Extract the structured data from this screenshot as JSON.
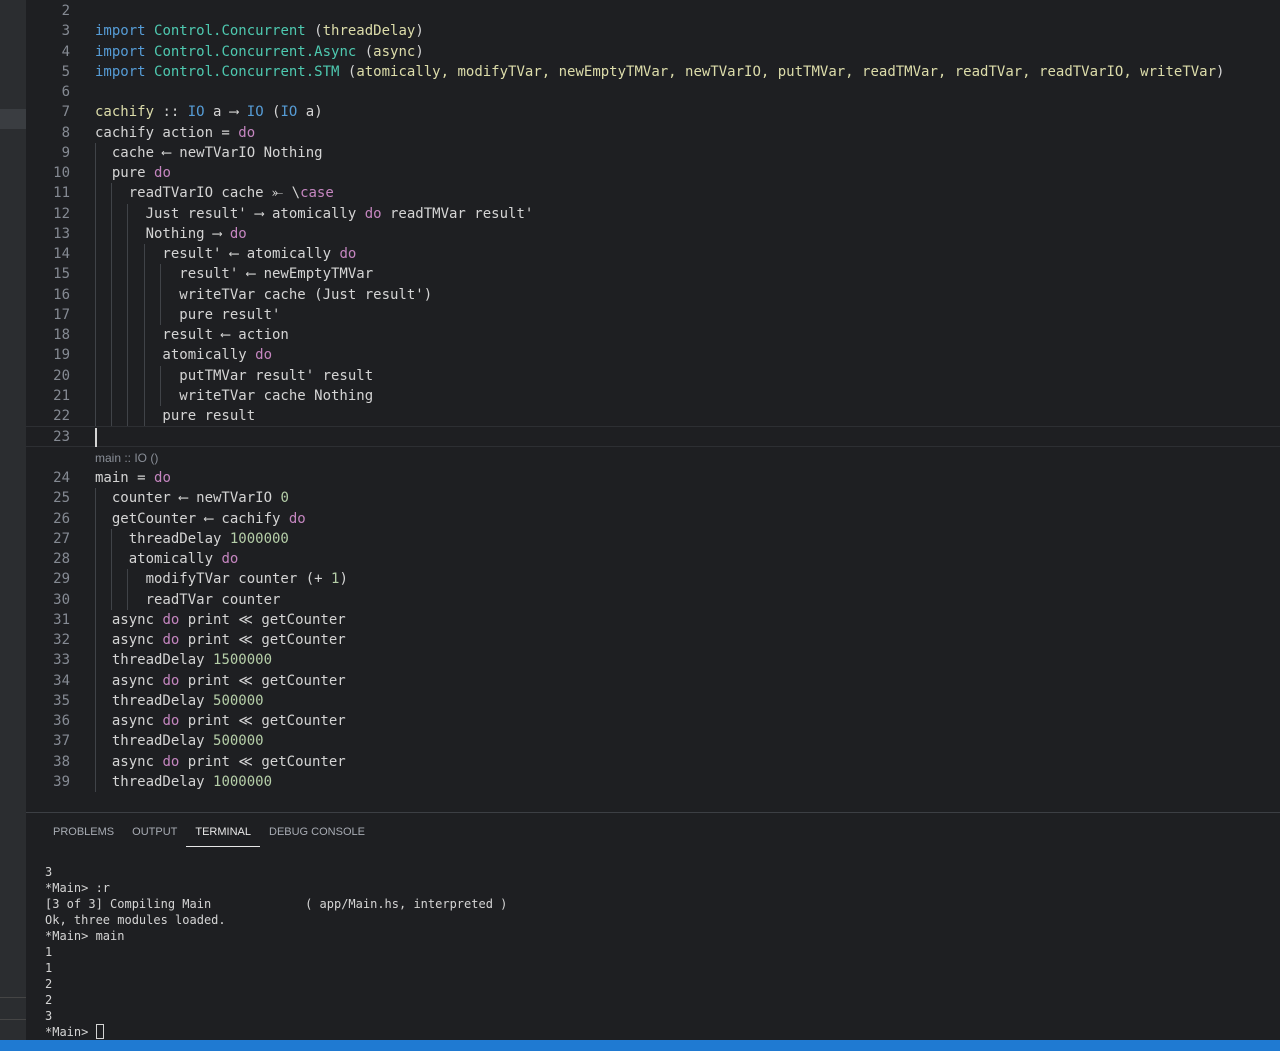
{
  "editor": {
    "lines": [
      {
        "n": "2",
        "tokens": []
      },
      {
        "n": "3",
        "tokens": [
          {
            "t": "import",
            "c": "kw"
          },
          {
            "t": " ",
            "c": "plain"
          },
          {
            "t": "Control.Concurrent",
            "c": "mod"
          },
          {
            "t": " (",
            "c": "plain"
          },
          {
            "t": "threadDelay",
            "c": "fn"
          },
          {
            "t": ")",
            "c": "plain"
          }
        ]
      },
      {
        "n": "4",
        "tokens": [
          {
            "t": "import",
            "c": "kw"
          },
          {
            "t": " ",
            "c": "plain"
          },
          {
            "t": "Control.Concurrent.Async",
            "c": "mod"
          },
          {
            "t": " (",
            "c": "plain"
          },
          {
            "t": "async",
            "c": "fn"
          },
          {
            "t": ")",
            "c": "plain"
          }
        ]
      },
      {
        "n": "5",
        "tokens": [
          {
            "t": "import",
            "c": "kw"
          },
          {
            "t": " ",
            "c": "plain"
          },
          {
            "t": "Control.Concurrent.STM",
            "c": "mod"
          },
          {
            "t": " (",
            "c": "plain"
          },
          {
            "t": "atomically, modifyTVar, newEmptyTMVar, newTVarIO, putTMVar, readTMVar, readTVar, readTVarIO, writeTVar",
            "c": "fn"
          },
          {
            "t": ")",
            "c": "plain"
          }
        ]
      },
      {
        "n": "6",
        "tokens": []
      },
      {
        "n": "7",
        "tokens": [
          {
            "t": "cachify",
            "c": "fn"
          },
          {
            "t": " :: ",
            "c": "plain"
          },
          {
            "t": "IO",
            "c": "ty"
          },
          {
            "t": " a ",
            "c": "plain"
          },
          {
            "t": "⟶",
            "c": "plain"
          },
          {
            "t": " ",
            "c": "plain"
          },
          {
            "t": "IO",
            "c": "ty"
          },
          {
            "t": " (",
            "c": "plain"
          },
          {
            "t": "IO",
            "c": "ty"
          },
          {
            "t": " a)",
            "c": "plain"
          }
        ]
      },
      {
        "n": "8",
        "tokens": [
          {
            "t": "cachify action = ",
            "c": "plain"
          },
          {
            "t": "do",
            "c": "do"
          }
        ]
      },
      {
        "n": "9",
        "tokens": [
          {
            "t": "  cache ⟵ newTVarIO Nothing",
            "c": "plain"
          }
        ]
      },
      {
        "n": "10",
        "tokens": [
          {
            "t": "  pure ",
            "c": "plain"
          },
          {
            "t": "do",
            "c": "do"
          }
        ]
      },
      {
        "n": "11",
        "tokens": [
          {
            "t": "    readTVarIO cache ⤜ \\",
            "c": "plain"
          },
          {
            "t": "case",
            "c": "do"
          }
        ]
      },
      {
        "n": "12",
        "tokens": [
          {
            "t": "      Just result' ⟶ atomically ",
            "c": "plain"
          },
          {
            "t": "do",
            "c": "do"
          },
          {
            "t": " readTMVar result'",
            "c": "plain"
          }
        ]
      },
      {
        "n": "13",
        "tokens": [
          {
            "t": "      Nothing ⟶ ",
            "c": "plain"
          },
          {
            "t": "do",
            "c": "do"
          }
        ]
      },
      {
        "n": "14",
        "tokens": [
          {
            "t": "        result' ⟵ atomically ",
            "c": "plain"
          },
          {
            "t": "do",
            "c": "do"
          }
        ]
      },
      {
        "n": "15",
        "tokens": [
          {
            "t": "          result' ⟵ newEmptyTMVar",
            "c": "plain"
          }
        ]
      },
      {
        "n": "16",
        "tokens": [
          {
            "t": "          writeTVar cache (Just result')",
            "c": "plain"
          }
        ]
      },
      {
        "n": "17",
        "tokens": [
          {
            "t": "          pure result'",
            "c": "plain"
          }
        ]
      },
      {
        "n": "18",
        "tokens": [
          {
            "t": "        result ⟵ action",
            "c": "plain"
          }
        ]
      },
      {
        "n": "19",
        "tokens": [
          {
            "t": "        atomically ",
            "c": "plain"
          },
          {
            "t": "do",
            "c": "do"
          }
        ]
      },
      {
        "n": "20",
        "tokens": [
          {
            "t": "          putTMVar result' result",
            "c": "plain"
          }
        ]
      },
      {
        "n": "21",
        "tokens": [
          {
            "t": "          writeTVar cache Nothing",
            "c": "plain"
          }
        ]
      },
      {
        "n": "22",
        "tokens": [
          {
            "t": "        pure result",
            "c": "plain"
          }
        ]
      },
      {
        "n": "23",
        "tokens": []
      }
    ],
    "lens": "main :: IO ()",
    "lines2": [
      {
        "n": "24",
        "tokens": [
          {
            "t": "main = ",
            "c": "plain"
          },
          {
            "t": "do",
            "c": "do"
          }
        ]
      },
      {
        "n": "25",
        "tokens": [
          {
            "t": "  counter ⟵ newTVarIO ",
            "c": "plain"
          },
          {
            "t": "0",
            "c": "num"
          }
        ]
      },
      {
        "n": "26",
        "tokens": [
          {
            "t": "  getCounter ⟵ cachify ",
            "c": "plain"
          },
          {
            "t": "do",
            "c": "do"
          }
        ]
      },
      {
        "n": "27",
        "tokens": [
          {
            "t": "    threadDelay ",
            "c": "plain"
          },
          {
            "t": "1000000",
            "c": "num"
          }
        ]
      },
      {
        "n": "28",
        "tokens": [
          {
            "t": "    atomically ",
            "c": "plain"
          },
          {
            "t": "do",
            "c": "do"
          }
        ]
      },
      {
        "n": "29",
        "tokens": [
          {
            "t": "      modifyTVar counter (+ ",
            "c": "plain"
          },
          {
            "t": "1",
            "c": "num"
          },
          {
            "t": ")",
            "c": "plain"
          }
        ]
      },
      {
        "n": "30",
        "tokens": [
          {
            "t": "      readTVar counter",
            "c": "plain"
          }
        ]
      },
      {
        "n": "31",
        "tokens": [
          {
            "t": "  async ",
            "c": "plain"
          },
          {
            "t": "do",
            "c": "do"
          },
          {
            "t": " print ≪ getCounter",
            "c": "plain"
          }
        ]
      },
      {
        "n": "32",
        "tokens": [
          {
            "t": "  async ",
            "c": "plain"
          },
          {
            "t": "do",
            "c": "do"
          },
          {
            "t": " print ≪ getCounter",
            "c": "plain"
          }
        ]
      },
      {
        "n": "33",
        "tokens": [
          {
            "t": "  threadDelay ",
            "c": "plain"
          },
          {
            "t": "1500000",
            "c": "num"
          }
        ]
      },
      {
        "n": "34",
        "tokens": [
          {
            "t": "  async ",
            "c": "plain"
          },
          {
            "t": "do",
            "c": "do"
          },
          {
            "t": " print ≪ getCounter",
            "c": "plain"
          }
        ]
      },
      {
        "n": "35",
        "tokens": [
          {
            "t": "  threadDelay ",
            "c": "plain"
          },
          {
            "t": "500000",
            "c": "num"
          }
        ]
      },
      {
        "n": "36",
        "tokens": [
          {
            "t": "  async ",
            "c": "plain"
          },
          {
            "t": "do",
            "c": "do"
          },
          {
            "t": " print ≪ getCounter",
            "c": "plain"
          }
        ]
      },
      {
        "n": "37",
        "tokens": [
          {
            "t": "  threadDelay ",
            "c": "plain"
          },
          {
            "t": "500000",
            "c": "num"
          }
        ]
      },
      {
        "n": "38",
        "tokens": [
          {
            "t": "  async ",
            "c": "plain"
          },
          {
            "t": "do",
            "c": "do"
          },
          {
            "t": " print ≪ getCounter",
            "c": "plain"
          }
        ]
      },
      {
        "n": "39",
        "tokens": [
          {
            "t": "  threadDelay ",
            "c": "plain"
          },
          {
            "t": "1000000",
            "c": "num"
          }
        ]
      }
    ]
  },
  "panel": {
    "tabs": [
      {
        "label": "PROBLEMS",
        "active": false
      },
      {
        "label": "OUTPUT",
        "active": false
      },
      {
        "label": "TERMINAL",
        "active": true
      },
      {
        "label": "DEBUG CONSOLE",
        "active": false
      }
    ],
    "terminal": [
      "3",
      "*Main> :r",
      "[3 of 3] Compiling Main             ( app/Main.hs, interpreted )",
      "Ok, three modules loaded.",
      "*Main> main",
      "1",
      "1",
      "2",
      "2",
      "3"
    ],
    "prompt": "*Main> "
  }
}
